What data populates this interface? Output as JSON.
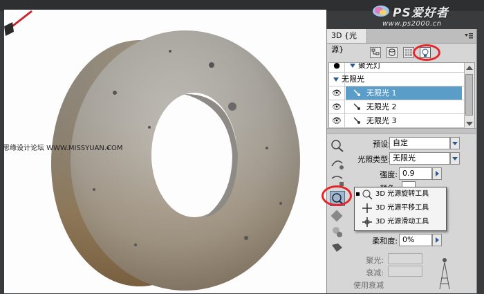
{
  "watermark": {
    "left_text": "思缘设计论坛 WWW.MISSYUAN.COM",
    "brand": "PS爱好者",
    "site": "www.ps2000.cn"
  },
  "panel": {
    "tab_label": "3D {光源}",
    "menu_icon": "panel-menu-icon",
    "filter_buttons": [
      "scene-filter-icon",
      "mesh-filter-icon",
      "material-filter-icon",
      "light-filter-icon"
    ],
    "layers": [
      {
        "label": "聚光灯",
        "kind": "group",
        "selected": false
      },
      {
        "label": "无限光",
        "kind": "group",
        "selected": false
      },
      {
        "label": "无限光 1",
        "kind": "light",
        "selected": true
      },
      {
        "label": "无限光 2",
        "kind": "light",
        "selected": false
      },
      {
        "label": "无限光 3",
        "kind": "light",
        "selected": false
      }
    ],
    "properties": {
      "preset_label": "预设:",
      "preset_value": "自定",
      "light_type_label": "光照类型:",
      "light_type_value": "无限光",
      "intensity_label": "强度:",
      "intensity_value": "0.9",
      "color_label": "颜色:",
      "softness_label": "柔和度:",
      "softness_value": "0%",
      "hotspot_label": "聚光:",
      "falloff_label": "衰减:",
      "use_attenuation_label": "使用衰减"
    },
    "flyout": [
      {
        "label": "3D 光源旋转工具",
        "icon": "light-rotate-icon",
        "checked": true
      },
      {
        "label": "3D 光源平移工具",
        "icon": "light-pan-icon",
        "checked": false
      },
      {
        "label": "3D 光源滑动工具",
        "icon": "light-slide-icon",
        "checked": false
      }
    ]
  },
  "colors": {
    "highlight": "#e2262a",
    "selection": "#5b9dc9",
    "panel_bg": "#d6d6d6"
  }
}
